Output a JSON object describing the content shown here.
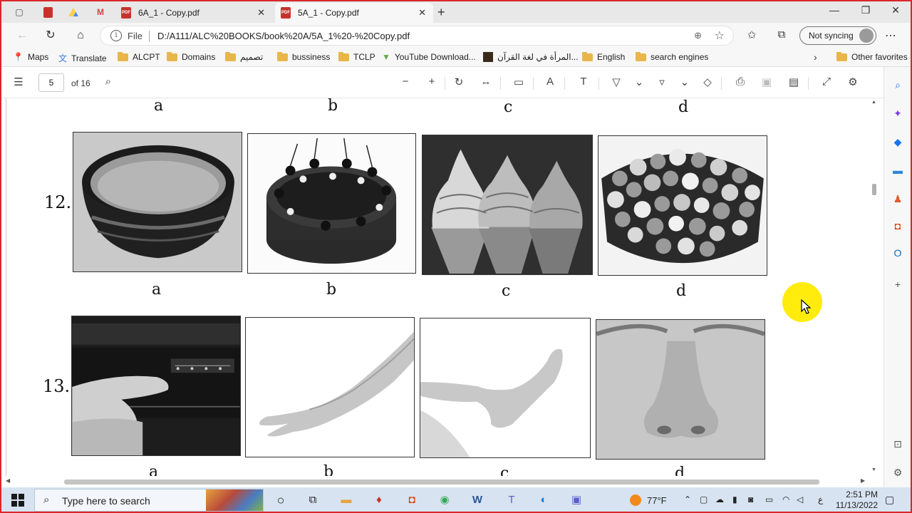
{
  "browser": {
    "tabs": [
      {
        "label": "6A_1 - Copy.pdf",
        "active": false
      },
      {
        "label": "5A_1 - Copy.pdf",
        "active": true
      }
    ],
    "address": {
      "scheme_label": "File",
      "url": "D:/A111/ALC%20BOOKS/book%20A/5A_1%20-%20Copy.pdf"
    },
    "sync_label": "Not syncing"
  },
  "favorites": [
    {
      "label": "Maps",
      "icon": "maps-pin-icon"
    },
    {
      "label": "Translate",
      "icon": "translate-icon"
    },
    {
      "label": "ALCPT",
      "icon": "folder-icon"
    },
    {
      "label": "Domains",
      "icon": "folder-icon"
    },
    {
      "label": "تصميم",
      "icon": "folder-icon"
    },
    {
      "label": "bussiness",
      "icon": "folder-icon"
    },
    {
      "label": "TCLP",
      "icon": "folder-icon"
    },
    {
      "label": "YouTube Download...",
      "icon": "download-icon"
    },
    {
      "label": "المرأة في لغة القرآن...",
      "icon": "book-icon"
    },
    {
      "label": "English",
      "icon": "folder-icon"
    },
    {
      "label": "search engines",
      "icon": "folder-icon"
    },
    {
      "label": "Other favorites",
      "icon": "folder-icon"
    }
  ],
  "pdf_toolbar": {
    "page_current": "5",
    "page_total_label": "of 16"
  },
  "document": {
    "top_row_letters": [
      "a",
      "b",
      "c",
      "d"
    ],
    "question_12": {
      "number": "12.",
      "letters": [
        "a",
        "b",
        "c",
        "d"
      ],
      "images": [
        "bowl",
        "cake",
        "ice-cream-cones",
        "candy-bowl"
      ]
    },
    "question_13": {
      "number": "13.",
      "letters": [
        "a",
        "b",
        "c",
        "d"
      ],
      "images": [
        "finger-pressing-button",
        "arm",
        "foot",
        "nose"
      ]
    }
  },
  "taskbar": {
    "search_placeholder": "Type here to search",
    "weather": "77°F",
    "time": "2:51 PM",
    "date": "11/13/2022",
    "lang": "ع"
  }
}
